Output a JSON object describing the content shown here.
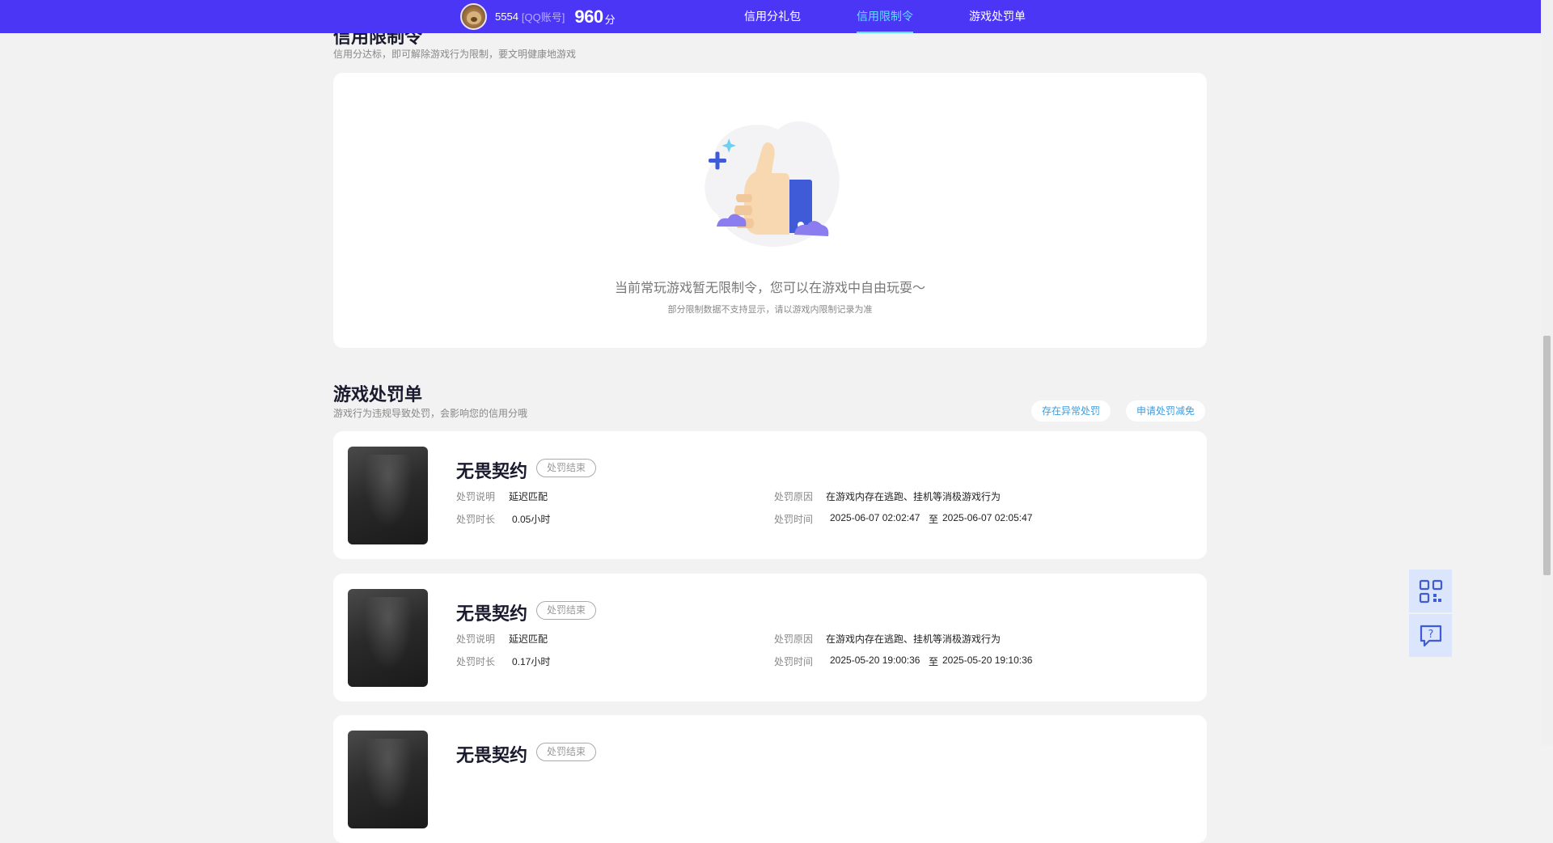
{
  "header": {
    "qq_number": "5554",
    "qq_label": "[QQ账号]",
    "score": "960",
    "score_unit": "分",
    "nav": [
      {
        "label": "信用分礼包"
      },
      {
        "label": "信用限制令"
      },
      {
        "label": "游戏处罚单"
      }
    ]
  },
  "restriction": {
    "title": "信用限制令",
    "subtitle": "信用分达标，即可解除游戏行为限制，要文明健康地游戏",
    "empty_text": "当前常玩游戏暂无限制令，您可以在游戏中自由玩耍～",
    "empty_note": "部分限制数据不支持显示，请以游戏内限制记录为准"
  },
  "penalties": {
    "title": "游戏处罚单",
    "subtitle": "游戏行为违规导致处罚，会影响您的信用分哦",
    "report_button": "存在异常处罚",
    "appeal_button": "申请处罚减免",
    "labels": {
      "desc": "处罚说明",
      "duration": "处罚时长",
      "reason": "处罚原因",
      "time": "处罚时间",
      "to": "至"
    },
    "items": [
      {
        "game": "无畏契约",
        "status": "处罚结束",
        "desc": "延迟匹配",
        "duration": "0.05小时",
        "reason": "在游戏内存在逃跑、挂机等消极游戏行为",
        "start": "2025-06-07 02:02:47",
        "end": "2025-06-07 02:05:47"
      },
      {
        "game": "无畏契约",
        "status": "处罚结束",
        "desc": "延迟匹配",
        "duration": "0.17小时",
        "reason": "在游戏内存在逃跑、挂机等消极游戏行为",
        "start": "2025-05-20 19:00:36",
        "end": "2025-05-20 19:10:36"
      },
      {
        "game": "无畏契约",
        "status": "处罚结束"
      }
    ]
  },
  "icons": {
    "qr": "qr-code-icon",
    "feedback": "feedback-icon",
    "avatar": "avatar"
  },
  "colors": {
    "header_bg": "#4c36f5",
    "nav_active": "#5de0ff",
    "page_bg": "#f2f2f2",
    "link": "#3b9dde"
  }
}
